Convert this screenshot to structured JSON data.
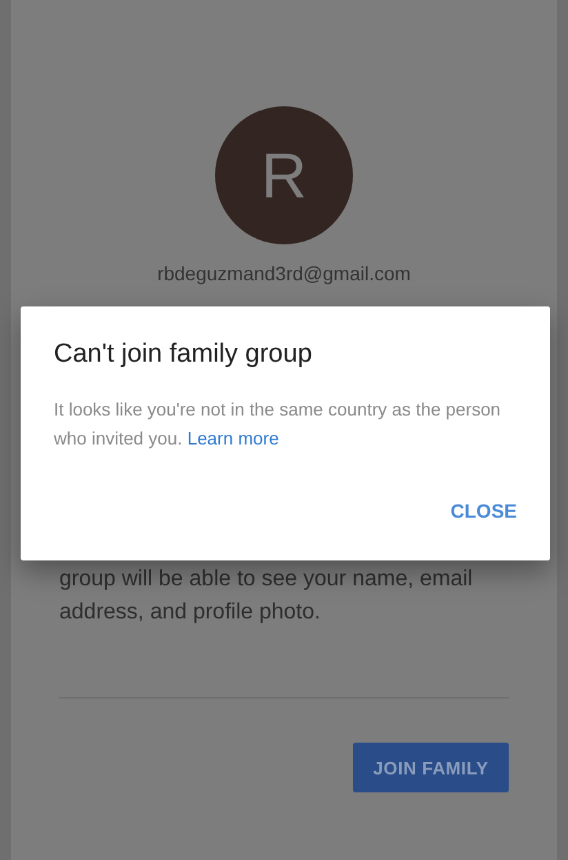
{
  "account": {
    "avatar_letter": "R",
    "email": "rbdeguzmand3rd@gmail.com"
  },
  "notice": [
    "group will be able to see your name, email",
    "address, and profile photo."
  ],
  "join_button": {
    "label": "JOIN FAMILY"
  },
  "dialog": {
    "title": "Can't join family group",
    "message": "It looks like you're not in the same country as the person who invited you.",
    "link": "Learn more",
    "buttons": [
      "CLOSE"
    ]
  }
}
